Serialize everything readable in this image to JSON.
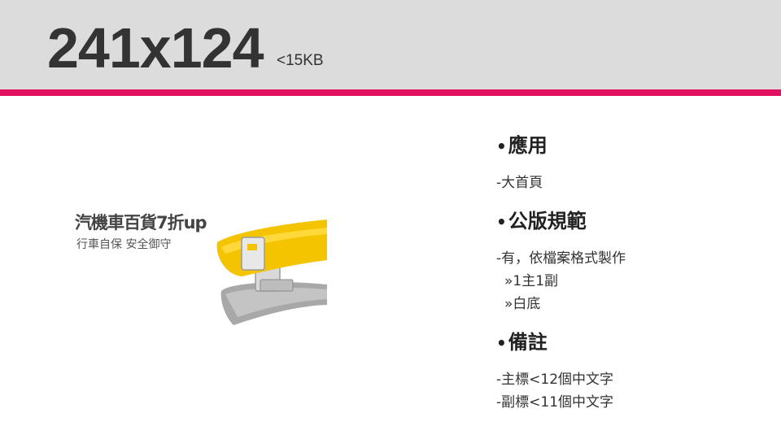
{
  "header": {
    "title": "241x124",
    "size_limit": "<15KB"
  },
  "banner": {
    "main_title": "汽機車百貨7折up",
    "subtitle": "行車自保 安全御守",
    "image_icon": "car-sun-visor-image"
  },
  "spec": {
    "bullet": "•",
    "sections": [
      {
        "heading": "應用",
        "items": [
          "-大首頁"
        ]
      },
      {
        "heading": "公版規範",
        "items": [
          "-有，依檔案格式製作"
        ],
        "subitems": [
          "»1主1副",
          "»白底"
        ]
      },
      {
        "heading": "備註",
        "items": [
          "-主標<12個中文字",
          "-副標<11個中文字"
        ]
      }
    ]
  },
  "colors": {
    "header_bg": "#dcdcdc",
    "accent": "#e0115f",
    "visor_yellow": "#f5c400"
  }
}
